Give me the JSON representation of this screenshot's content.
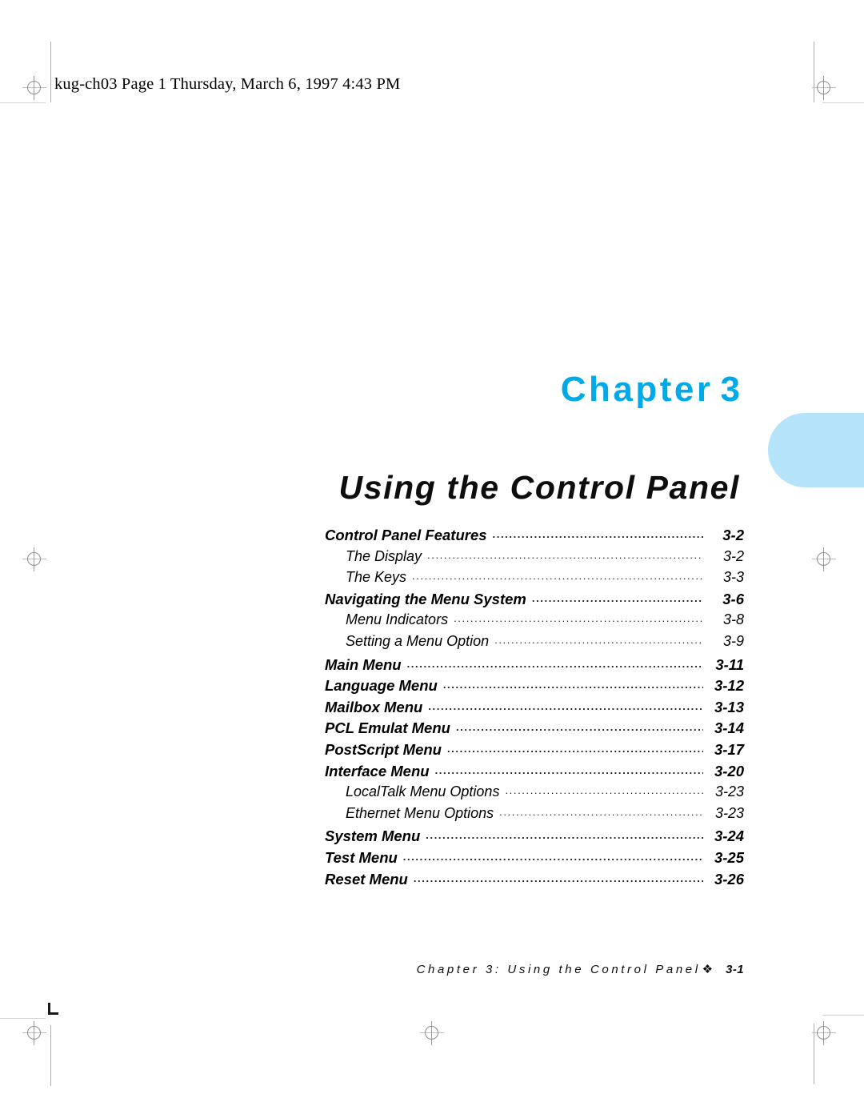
{
  "header": {
    "file_stamp": "kug-ch03  Page 1  Thursday, March 6, 1997  4:43 PM"
  },
  "chapter": {
    "label": "Chapter",
    "number": "3",
    "title": "Using the Control Panel",
    "accent_color": "#00a9e8",
    "tab_color": "#b5e3fa"
  },
  "toc": {
    "entries": [
      {
        "level": 1,
        "label": "Control Panel Features",
        "page": "3-2"
      },
      {
        "level": 2,
        "label": "The Display",
        "page": "3-2"
      },
      {
        "level": 2,
        "label": "The Keys",
        "page": "3-3"
      },
      {
        "level": 1,
        "label": "Navigating the Menu System",
        "page": "3-6"
      },
      {
        "level": 2,
        "label": "Menu Indicators",
        "page": "3-8"
      },
      {
        "level": 2,
        "label": "Setting a Menu Option",
        "page": "3-9"
      },
      {
        "level": 1,
        "label": "Main Menu",
        "page": "3-11"
      },
      {
        "level": 1,
        "label": "Language Menu",
        "page": "3-12"
      },
      {
        "level": 1,
        "label": "Mailbox Menu",
        "page": "3-13"
      },
      {
        "level": 1,
        "label": "PCL Emulat Menu",
        "page": "3-14"
      },
      {
        "level": 1,
        "label": "PostScript Menu",
        "page": "3-17"
      },
      {
        "level": 1,
        "label": "Interface Menu",
        "page": "3-20"
      },
      {
        "level": 2,
        "label": "LocalTalk Menu Options",
        "page": "3-23"
      },
      {
        "level": 2,
        "label": "Ethernet Menu Options",
        "page": "3-23"
      },
      {
        "level": 1,
        "label": "System Menu",
        "page": "3-24"
      },
      {
        "level": 1,
        "label": "Test Menu",
        "page": "3-25"
      },
      {
        "level": 1,
        "label": "Reset Menu",
        "page": "3-26"
      }
    ],
    "leader_char": "."
  },
  "footer": {
    "text": "Chapter 3: Using the Control Panel",
    "ornament": "❖",
    "page": "3-1"
  },
  "print_marks": {
    "registration_icon": "registration-crosshair",
    "corner_icon": "crop-corner-L"
  }
}
